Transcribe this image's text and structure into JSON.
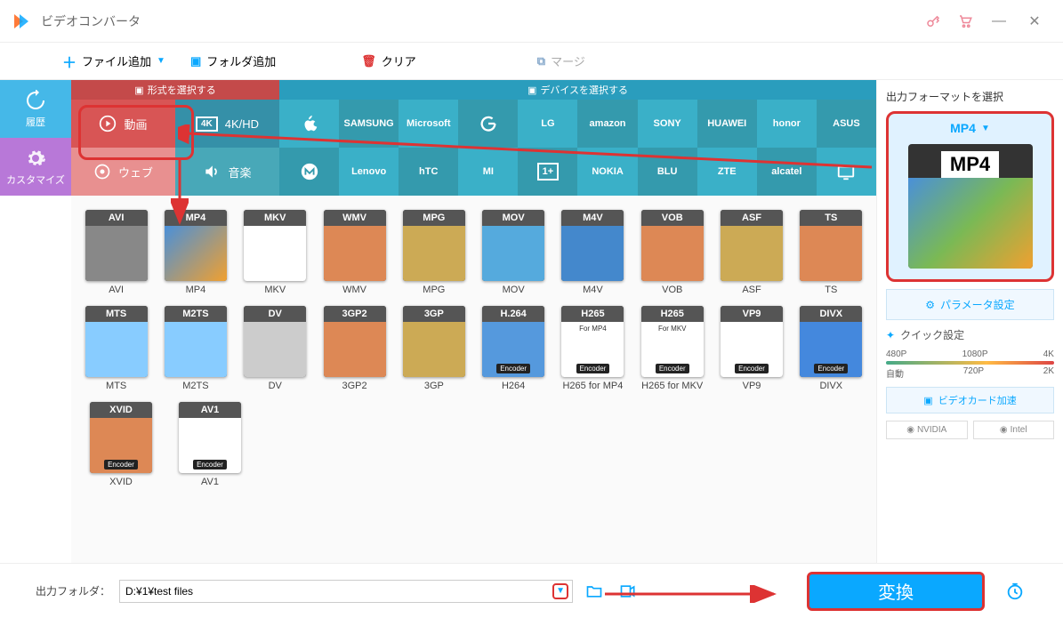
{
  "app": {
    "title": "ビデオコンバータ"
  },
  "toolbar": {
    "add_file": "ファイル追加",
    "add_folder": "フォルダ追加",
    "clear": "クリア",
    "merge": "マージ"
  },
  "sidebar": {
    "history": "履歴",
    "customize": "カスタマイズ"
  },
  "tabs": {
    "format": "形式を選択する",
    "device": "デバイスを選択する"
  },
  "categories": {
    "video": "動画",
    "web": "ウェブ",
    "fourk": "4K/HD",
    "music": "音楽"
  },
  "brands": {
    "row1": [
      "Apple",
      "SAMSUNG",
      "Microsoft",
      "G",
      "LG",
      "amazon",
      "SONY",
      "HUAWEI",
      "honor",
      "ASUS"
    ],
    "row2": [
      "M",
      "Lenovo",
      "hTC",
      "MI",
      "1+",
      "NOKIA",
      "BLU",
      "ZTE",
      "alcatel",
      "TV"
    ]
  },
  "formats": [
    [
      {
        "badge": "AVI",
        "label": "AVI"
      },
      {
        "badge": "MP4",
        "label": "MP4"
      },
      {
        "badge": "MKV",
        "label": "MKV"
      },
      {
        "badge": "WMV",
        "label": "WMV"
      },
      {
        "badge": "MPG",
        "label": "MPG"
      },
      {
        "badge": "MOV",
        "label": "MOV"
      },
      {
        "badge": "M4V",
        "label": "M4V"
      },
      {
        "badge": "VOB",
        "label": "VOB"
      },
      {
        "badge": "ASF",
        "label": "ASF"
      },
      {
        "badge": "TS",
        "label": "TS"
      }
    ],
    [
      {
        "badge": "MTS",
        "label": "MTS"
      },
      {
        "badge": "M2TS",
        "label": "M2TS"
      },
      {
        "badge": "DV",
        "label": "DV"
      },
      {
        "badge": "3GP2",
        "label": "3GP2"
      },
      {
        "badge": "3GP",
        "label": "3GP"
      },
      {
        "badge": "H.264",
        "label": "H264",
        "enc": "Encoder"
      },
      {
        "badge": "H265",
        "label": "H265 for MP4",
        "sub": "For MP4",
        "enc": "Encoder"
      },
      {
        "badge": "H265",
        "label": "H265 for MKV",
        "sub": "For MKV",
        "enc": "Encoder"
      },
      {
        "badge": "VP9",
        "label": "VP9",
        "enc": "Encoder"
      },
      {
        "badge": "DIVX",
        "label": "DIVX",
        "enc": "Encoder"
      }
    ],
    [
      {
        "badge": "XVID",
        "label": "XVID",
        "enc": "Encoder"
      },
      {
        "badge": "AV1",
        "label": "AV1",
        "enc": "Encoder"
      }
    ]
  ],
  "right": {
    "title": "出力フォーマットを選択",
    "selected": "MP4",
    "thumb_label": "MP4",
    "params": "パラメータ設定",
    "quick": "クイック設定",
    "res_top": [
      "480P",
      "1080P",
      "4K"
    ],
    "res_bottom": [
      "自動",
      "720P",
      "2K"
    ],
    "gpu": "ビデオカード加速",
    "vendors": [
      "NVIDIA",
      "Intel"
    ]
  },
  "bottom": {
    "label": "出力フォルダ：",
    "path": "D:¥1¥test files",
    "convert": "変換"
  }
}
